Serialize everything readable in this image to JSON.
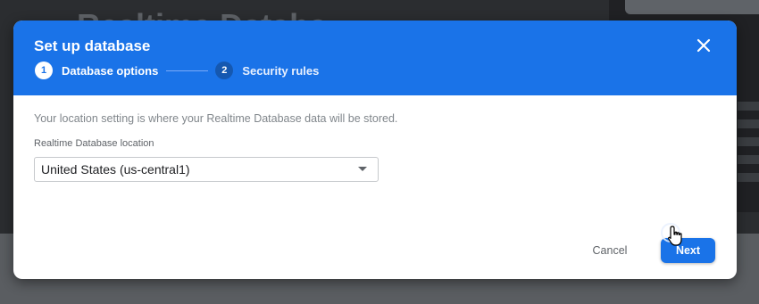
{
  "background": {
    "page_title": "Realtime Databa"
  },
  "dialog": {
    "title": "Set up database",
    "close_icon": "close-icon",
    "steps": [
      {
        "number": "1",
        "label": "Database options",
        "state": "active"
      },
      {
        "number": "2",
        "label": "Security rules",
        "state": "inactive"
      }
    ],
    "info_text": "Your location setting is where your Realtime Database data will be stored.",
    "location_label": "Realtime Database location",
    "location_value": "United States (us-central1)",
    "dropdown_icon": "chevron-down-icon",
    "cancel_label": "Cancel",
    "next_label": "Next"
  },
  "colors": {
    "header": "#1a73e8",
    "primary_button": "#1a73e8",
    "overlay": "#2b2d30"
  }
}
